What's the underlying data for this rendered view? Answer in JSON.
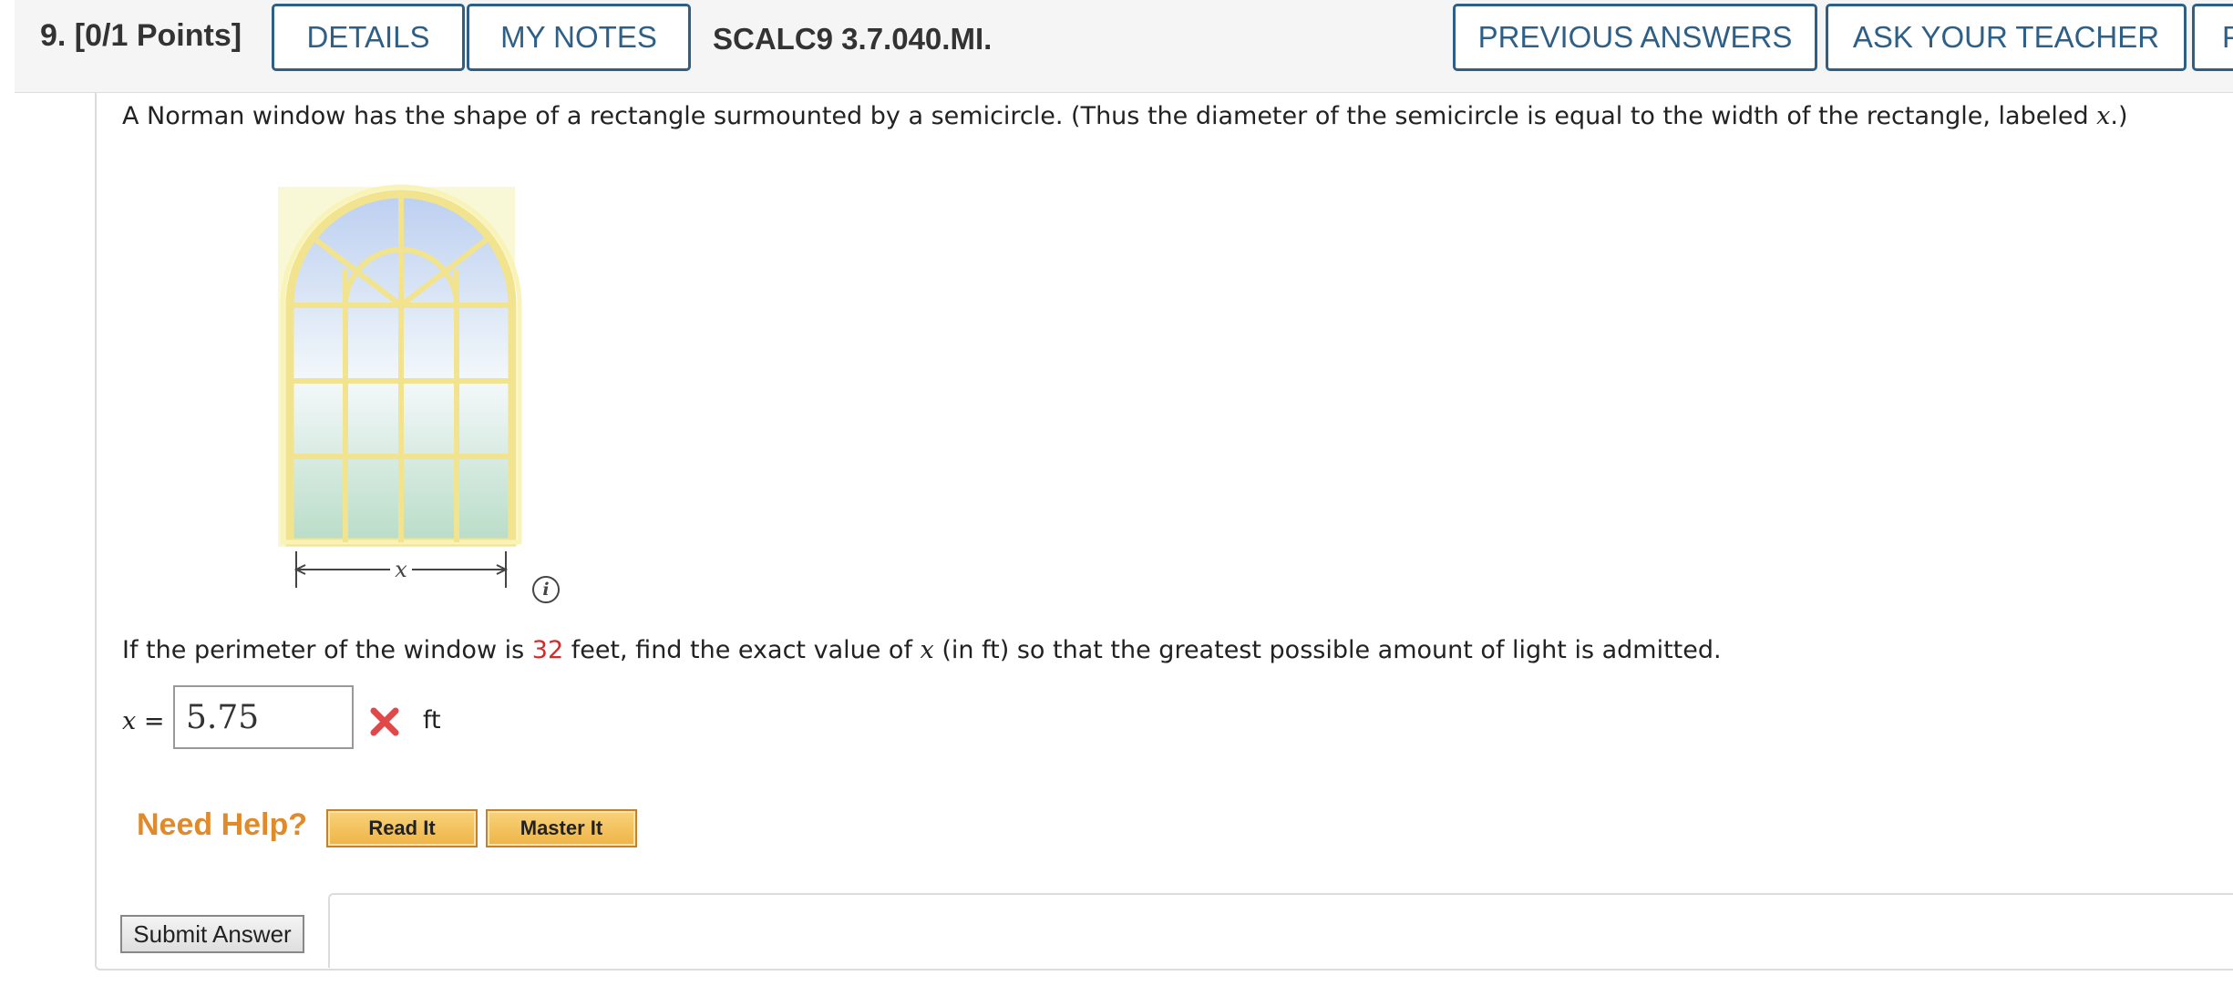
{
  "header": {
    "question_title": "9.  [0/1 Points]",
    "details_label": "DETAILS",
    "my_notes_label": "MY NOTES",
    "question_code": "SCALC9 3.7.040.MI.",
    "previous_answers_label": "PREVIOUS ANSWERS",
    "ask_teacher_label": "ASK YOUR TEACHER",
    "cut_off_button_label": "P"
  },
  "question": {
    "intro_main": "A Norman window has the shape of a rectangle surmounted by a semicircle. (Thus the diameter of the semicircle is equal to the width of the rectangle, labeled ",
    "intro_var": "x",
    "intro_end": ".)",
    "figure_label": "x",
    "info_icon_glyph": "i",
    "prompt_part1": "If the perimeter of the window is ",
    "perimeter_value": "32",
    "prompt_part2": " feet, find the exact value of ",
    "prompt_var": "x",
    "prompt_part3": " (in ft) so that the greatest possible amount of light is admitted."
  },
  "answer": {
    "var_label": "x",
    "equals": " =",
    "value": "5.75",
    "status": "incorrect",
    "unit": "ft"
  },
  "help": {
    "need_help_label": "Need Help?",
    "read_it_label": "Read It",
    "master_it_label": "Master It"
  },
  "submit": {
    "label": "Submit Answer"
  },
  "colors": {
    "accent_blue": "#2e5f86",
    "help_orange": "#e08a2c",
    "highlight_red": "#d22b2b",
    "wrong_mark": "#e0484a"
  }
}
